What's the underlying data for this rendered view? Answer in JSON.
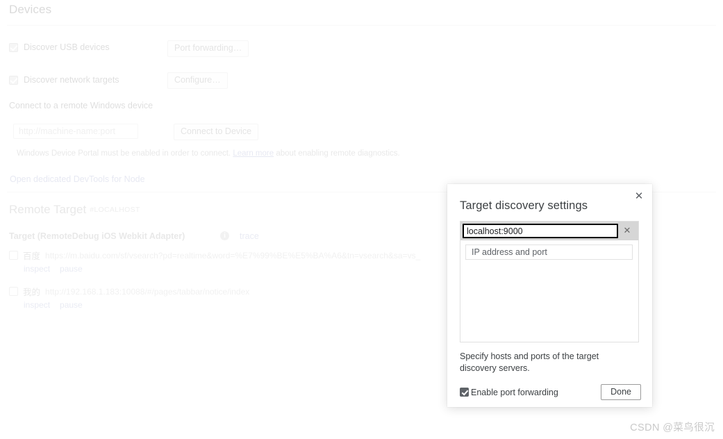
{
  "page": {
    "title": "Devices",
    "discover_usb": {
      "label": "Discover USB devices",
      "checked": true
    },
    "discover_network": {
      "label": "Discover network targets",
      "checked": true
    },
    "port_forwarding_button": "Port forwarding…",
    "configure_button": "Configure…",
    "connect_section_label": "Connect to a remote Windows device",
    "machine_input_placeholder": "http://machine-name:port",
    "machine_input_value": "",
    "connect_button": "Connect to Device",
    "hint_prefix": "Windows Device Portal must be enabled in order to connect.",
    "hint_link": "Learn more",
    "hint_suffix": "about enabling remote diagnostics.",
    "node_link": "Open dedicated DevTools for Node"
  },
  "remote": {
    "heading": "Remote Target",
    "heading_hash": "#LOCALHOST",
    "target_name": "Target (RemoteDebug iOS Webkit Adapter)",
    "info_icon_glyph": "i",
    "trace_link": "trace",
    "targets": [
      {
        "checked": false,
        "name": "百度",
        "url": "https://m.baidu.com/sf/vsearch?pd=realtime&word=%E7%99%BE%E5%BA%A6&tn=vsearch&sa=vs_",
        "inspect": "inspect",
        "pause": "pause"
      },
      {
        "checked": false,
        "name": "我的",
        "url": "http://192.168.1.183:10088/#/pages/tabbar/notice/index",
        "inspect": "inspect",
        "pause": "pause"
      }
    ]
  },
  "dialog": {
    "title": "Target discovery settings",
    "close_glyph": "✕",
    "entries": [
      {
        "value": "localhost:9000",
        "remove_glyph": "✕",
        "selected": true
      }
    ],
    "new_entry_placeholder": "IP address and port",
    "new_entry_value": "",
    "description": "Specify hosts and ports of the target discovery servers.",
    "enable_port_forwarding": {
      "label": "Enable port forwarding",
      "checked": true
    },
    "done_button": "Done"
  },
  "watermark": "CSDN @菜鸟很沉",
  "colors": {
    "link": "#9aa5dd",
    "dialog_text": "#3c4043",
    "muted": "#9c9c9c",
    "selected_row": "#d6d6d6"
  }
}
